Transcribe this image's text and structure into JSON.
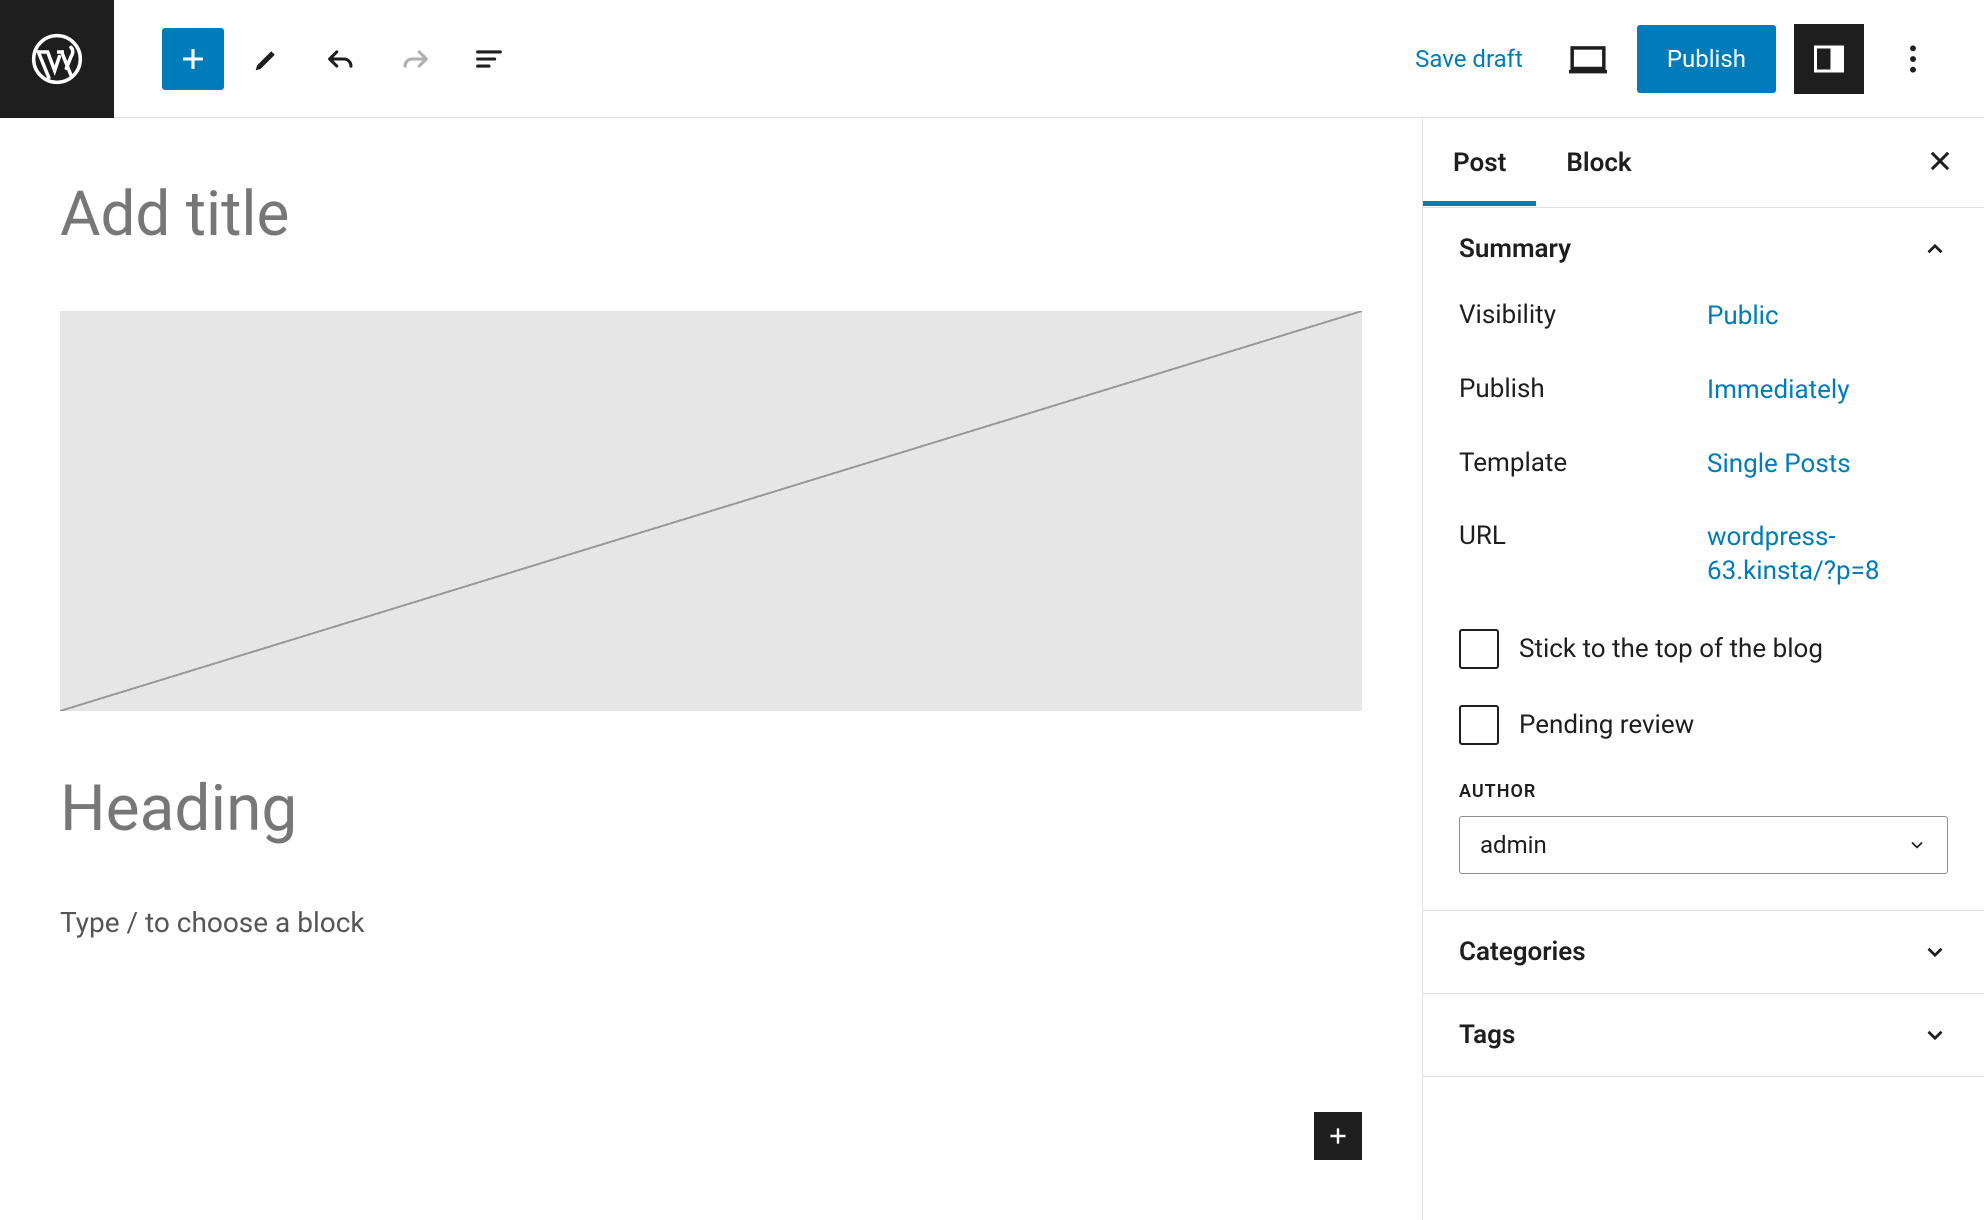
{
  "toolbar": {
    "save_draft": "Save draft",
    "publish": "Publish"
  },
  "editor": {
    "title_placeholder": "Add title",
    "heading_placeholder": "Heading",
    "paragraph_prompt": "Type / to choose a block"
  },
  "sidebar": {
    "tabs": {
      "post": "Post",
      "block": "Block"
    },
    "summary": {
      "title": "Summary",
      "visibility_label": "Visibility",
      "visibility_value": "Public",
      "publish_label": "Publish",
      "publish_value": "Immediately",
      "template_label": "Template",
      "template_value": "Single Posts",
      "url_label": "URL",
      "url_value": "wordpress-63.kinsta/?p=8",
      "sticky_label": "Stick to the top of the blog",
      "pending_label": "Pending review",
      "author_heading": "AUTHOR",
      "author_value": "admin"
    },
    "categories": {
      "title": "Categories"
    },
    "tags": {
      "title": "Tags"
    }
  }
}
